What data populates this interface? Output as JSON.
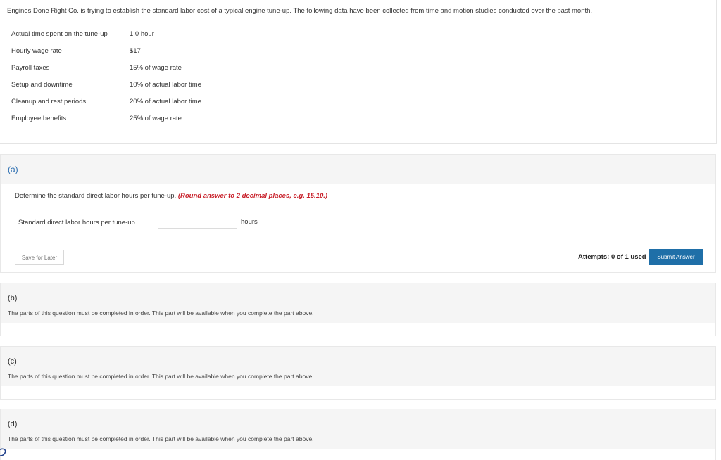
{
  "intro": {
    "text": "Engines Done Right Co. is trying to establish the standard labor cost of a typical engine tune-up. The following data have been collected from time and motion studies conducted over the past month."
  },
  "data_rows": [
    {
      "label": "Actual time spent on the tune-up",
      "value": "1.0 hour"
    },
    {
      "label": "Hourly wage rate",
      "value": "$17"
    },
    {
      "label": "Payroll taxes",
      "value": "15% of wage rate"
    },
    {
      "label": "Setup and downtime",
      "value": "10% of actual labor time"
    },
    {
      "label": "Cleanup and rest periods",
      "value": "20% of actual labor time"
    },
    {
      "label": "Employee benefits",
      "value": "25% of wage rate"
    }
  ],
  "part_a": {
    "letter": "(a)",
    "question": "Determine the standard direct labor hours per tune-up.",
    "hint": "(Round answer to 2 decimal places, e.g. 15.10.)",
    "field_label": "Standard direct labor hours per tune-up",
    "input_value": "",
    "unit": "hours",
    "save_label": "Save for Later",
    "attempts": "Attempts: 0 of 1 used",
    "submit_label": "Submit Answer"
  },
  "parts": [
    {
      "letter": "(b)",
      "note": "The parts of this question must be completed in order. This part will be available when you complete the part above."
    },
    {
      "letter": "(c)",
      "note": "The parts of this question must be completed in order. This part will be available when you complete the part above."
    },
    {
      "letter": "(d)",
      "note": "The parts of this question must be completed in order. This part will be available when you complete the part above."
    }
  ],
  "colors": {
    "accent": "#1f6fa8",
    "hint": "#c8202a",
    "part_letter": "#2a6db0"
  }
}
